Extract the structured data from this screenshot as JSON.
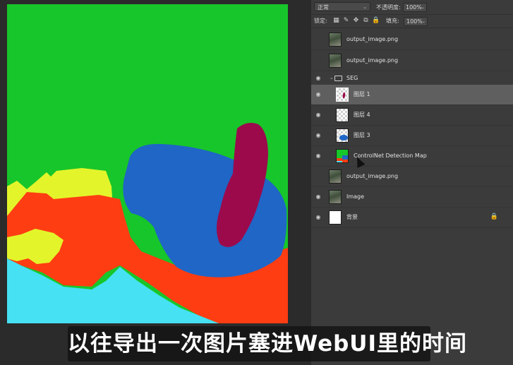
{
  "layers_panel": {
    "blend_mode": "正常",
    "opacity_label": "不透明度:",
    "opacity_value": "100%",
    "lock_label": "锁定:",
    "fill_label": "填充:",
    "fill_value": "100%",
    "layers": [
      {
        "name": "output_image.png",
        "type": "image",
        "visible": false,
        "selected": false
      },
      {
        "name": "output_image.png",
        "type": "image",
        "visible": false,
        "selected": false
      },
      {
        "name": "SEG",
        "type": "group",
        "visible": true,
        "selected": false
      },
      {
        "name": "图层 1",
        "type": "mask",
        "visible": true,
        "selected": true
      },
      {
        "name": "图层 4",
        "type": "mask",
        "visible": true,
        "selected": false
      },
      {
        "name": "图层 3",
        "type": "mask",
        "visible": true,
        "selected": false
      },
      {
        "name": "ControlNet Detection Map",
        "type": "seg",
        "visible": true,
        "selected": false
      },
      {
        "name": "output_image.png",
        "type": "image",
        "visible": false,
        "selected": false
      },
      {
        "name": "Image",
        "type": "image",
        "visible": true,
        "selected": false
      },
      {
        "name": "背景",
        "type": "white",
        "visible": true,
        "selected": false,
        "locked": true
      }
    ]
  },
  "canvas": {
    "segment_colors": {
      "sky_green": "#17c62a",
      "blue": "#1f66c6",
      "maroon": "#9c0a4c",
      "red": "#ff3d12",
      "yellow": "#e3f52a",
      "cyan": "#46e1f2"
    }
  },
  "subtitle": "以往导出一次图片塞进WebUI里的时间"
}
